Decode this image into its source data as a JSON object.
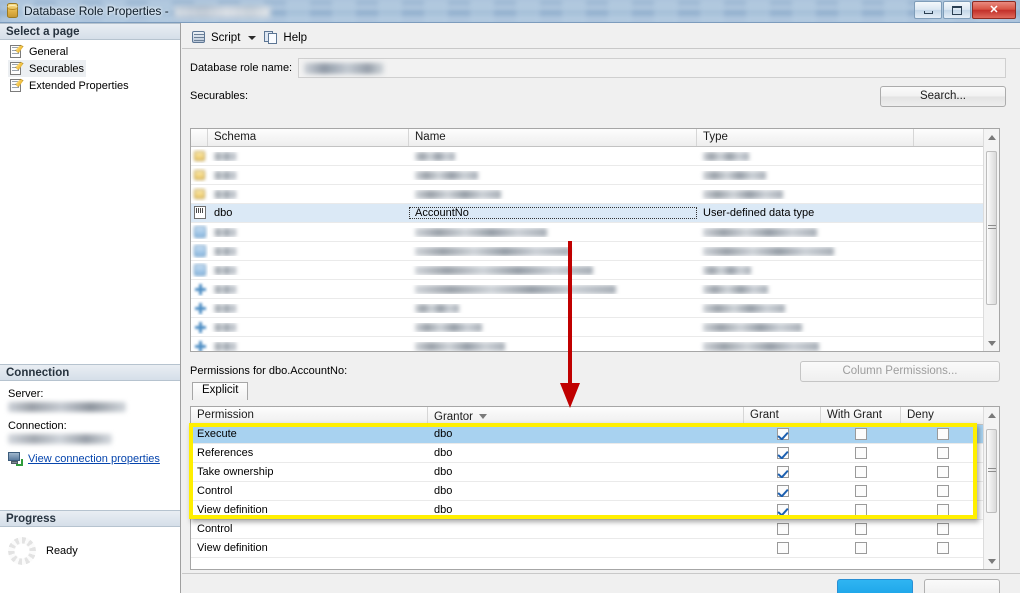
{
  "window": {
    "title": "Database Role Properties - ",
    "title_redacted": true,
    "icon": "database-role-icon",
    "buttons": {
      "minimize": "Minimize",
      "maximize": "Maximize",
      "close": "Close"
    }
  },
  "sidebar": {
    "select_page_header": "Select a page",
    "pages": [
      {
        "label": "General",
        "icon": "page-icon",
        "selected": false
      },
      {
        "label": "Securables",
        "icon": "page-icon",
        "selected": true
      },
      {
        "label": "Extended Properties",
        "icon": "page-icon",
        "selected": false
      }
    ],
    "connection": {
      "header": "Connection",
      "server_label": "Server:",
      "server_value": "",
      "connection_label": "Connection:",
      "connection_value": "",
      "view_properties_link": "View connection properties",
      "link_icon": "connection-icon"
    },
    "progress": {
      "header": "Progress",
      "status": "Ready",
      "icon": "progress-spinner-icon"
    }
  },
  "toolbar": {
    "script_label": "Script",
    "script_icon": "script-icon",
    "script_dropdown_icon": "chevron-down-icon",
    "help_label": "Help",
    "help_icon": "help-icon"
  },
  "form": {
    "role_name_label": "Database role name:",
    "role_name_value": "",
    "securables_label": "Securables:",
    "search_button": "Search..."
  },
  "securables_grid": {
    "columns": [
      "",
      "Schema",
      "Name",
      "Type",
      ""
    ],
    "rows": [
      {
        "icon": "key-icon",
        "schema": "",
        "name": "",
        "type": "",
        "redacted": true,
        "selected": false
      },
      {
        "icon": "key-icon",
        "schema": "",
        "name": "",
        "type": "",
        "redacted": true,
        "selected": false
      },
      {
        "icon": "key-icon",
        "schema": "",
        "name": "",
        "type": "",
        "redacted": true,
        "selected": false
      },
      {
        "icon": "udt-icon",
        "schema": "dbo",
        "name": "AccountNo",
        "type": "User-defined data type",
        "redacted": false,
        "selected": true
      },
      {
        "icon": "function-icon",
        "schema": "",
        "name": "",
        "type": "",
        "redacted": true,
        "selected": false
      },
      {
        "icon": "function-icon",
        "schema": "",
        "name": "",
        "type": "",
        "redacted": true,
        "selected": false
      },
      {
        "icon": "function-icon",
        "schema": "",
        "name": "",
        "type": "",
        "redacted": true,
        "selected": false
      },
      {
        "icon": "procedure-icon",
        "schema": "",
        "name": "",
        "type": "",
        "redacted": true,
        "selected": false
      },
      {
        "icon": "procedure-icon",
        "schema": "",
        "name": "",
        "type": "",
        "redacted": true,
        "selected": false
      },
      {
        "icon": "procedure-icon",
        "schema": "",
        "name": "",
        "type": "",
        "redacted": true,
        "selected": false
      },
      {
        "icon": "procedure-icon",
        "schema": "",
        "name": "",
        "type": "",
        "redacted": true,
        "selected": false
      }
    ]
  },
  "permissions": {
    "title": "Permissions for dbo.AccountNo:",
    "column_permissions_button": "Column Permissions...",
    "column_permissions_disabled": true,
    "tabs": [
      {
        "label": "Explicit",
        "active": true
      }
    ],
    "columns": [
      "Permission",
      "Grantor",
      "Grant",
      "With Grant",
      "Deny"
    ],
    "grantor_sort_icon": "sort-descending-icon",
    "rows": [
      {
        "permission": "Execute",
        "grantor": "dbo",
        "grant": true,
        "with_grant": false,
        "deny": false,
        "selected": true,
        "highlighted": true
      },
      {
        "permission": "References",
        "grantor": "dbo",
        "grant": true,
        "with_grant": false,
        "deny": false,
        "selected": false,
        "highlighted": true
      },
      {
        "permission": "Take ownership",
        "grantor": "dbo",
        "grant": true,
        "with_grant": false,
        "deny": false,
        "selected": false,
        "highlighted": true
      },
      {
        "permission": "Control",
        "grantor": "dbo",
        "grant": true,
        "with_grant": false,
        "deny": false,
        "selected": false,
        "highlighted": true
      },
      {
        "permission": "View definition",
        "grantor": "dbo",
        "grant": true,
        "with_grant": false,
        "deny": false,
        "selected": false,
        "highlighted": true
      },
      {
        "permission": "Control",
        "grantor": "",
        "grant": false,
        "with_grant": false,
        "deny": false,
        "selected": false,
        "highlighted": false
      },
      {
        "permission": "View definition",
        "grantor": "",
        "grant": false,
        "with_grant": false,
        "deny": false,
        "selected": false,
        "highlighted": false
      }
    ]
  },
  "annotations": {
    "arrow": {
      "color": "#c00000",
      "name": "red-down-arrow"
    },
    "highlight_box": {
      "color": "#ffef00",
      "name": "yellow-highlight-box"
    }
  },
  "colors": {
    "highlight_yellow": "#ffef00",
    "annotation_red": "#c00000",
    "selected_row_blue": "#a8d2f0",
    "selected_securable_blue": "#dbe9f6",
    "link_blue": "#0645ad"
  }
}
